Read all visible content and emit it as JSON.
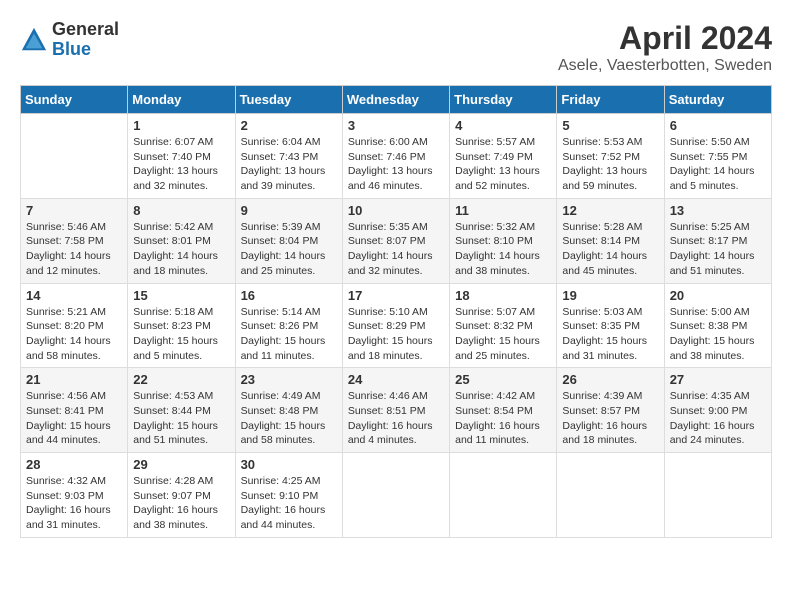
{
  "logo": {
    "general": "General",
    "blue": "Blue"
  },
  "title": {
    "month": "April 2024",
    "location": "Asele, Vaesterbotten, Sweden"
  },
  "headers": [
    "Sunday",
    "Monday",
    "Tuesday",
    "Wednesday",
    "Thursday",
    "Friday",
    "Saturday"
  ],
  "weeks": [
    [
      {
        "day": "",
        "content": ""
      },
      {
        "day": "1",
        "content": "Sunrise: 6:07 AM\nSunset: 7:40 PM\nDaylight: 13 hours\nand 32 minutes."
      },
      {
        "day": "2",
        "content": "Sunrise: 6:04 AM\nSunset: 7:43 PM\nDaylight: 13 hours\nand 39 minutes."
      },
      {
        "day": "3",
        "content": "Sunrise: 6:00 AM\nSunset: 7:46 PM\nDaylight: 13 hours\nand 46 minutes."
      },
      {
        "day": "4",
        "content": "Sunrise: 5:57 AM\nSunset: 7:49 PM\nDaylight: 13 hours\nand 52 minutes."
      },
      {
        "day": "5",
        "content": "Sunrise: 5:53 AM\nSunset: 7:52 PM\nDaylight: 13 hours\nand 59 minutes."
      },
      {
        "day": "6",
        "content": "Sunrise: 5:50 AM\nSunset: 7:55 PM\nDaylight: 14 hours\nand 5 minutes."
      }
    ],
    [
      {
        "day": "7",
        "content": "Sunrise: 5:46 AM\nSunset: 7:58 PM\nDaylight: 14 hours\nand 12 minutes."
      },
      {
        "day": "8",
        "content": "Sunrise: 5:42 AM\nSunset: 8:01 PM\nDaylight: 14 hours\nand 18 minutes."
      },
      {
        "day": "9",
        "content": "Sunrise: 5:39 AM\nSunset: 8:04 PM\nDaylight: 14 hours\nand 25 minutes."
      },
      {
        "day": "10",
        "content": "Sunrise: 5:35 AM\nSunset: 8:07 PM\nDaylight: 14 hours\nand 32 minutes."
      },
      {
        "day": "11",
        "content": "Sunrise: 5:32 AM\nSunset: 8:10 PM\nDaylight: 14 hours\nand 38 minutes."
      },
      {
        "day": "12",
        "content": "Sunrise: 5:28 AM\nSunset: 8:14 PM\nDaylight: 14 hours\nand 45 minutes."
      },
      {
        "day": "13",
        "content": "Sunrise: 5:25 AM\nSunset: 8:17 PM\nDaylight: 14 hours\nand 51 minutes."
      }
    ],
    [
      {
        "day": "14",
        "content": "Sunrise: 5:21 AM\nSunset: 8:20 PM\nDaylight: 14 hours\nand 58 minutes."
      },
      {
        "day": "15",
        "content": "Sunrise: 5:18 AM\nSunset: 8:23 PM\nDaylight: 15 hours\nand 5 minutes."
      },
      {
        "day": "16",
        "content": "Sunrise: 5:14 AM\nSunset: 8:26 PM\nDaylight: 15 hours\nand 11 minutes."
      },
      {
        "day": "17",
        "content": "Sunrise: 5:10 AM\nSunset: 8:29 PM\nDaylight: 15 hours\nand 18 minutes."
      },
      {
        "day": "18",
        "content": "Sunrise: 5:07 AM\nSunset: 8:32 PM\nDaylight: 15 hours\nand 25 minutes."
      },
      {
        "day": "19",
        "content": "Sunrise: 5:03 AM\nSunset: 8:35 PM\nDaylight: 15 hours\nand 31 minutes."
      },
      {
        "day": "20",
        "content": "Sunrise: 5:00 AM\nSunset: 8:38 PM\nDaylight: 15 hours\nand 38 minutes."
      }
    ],
    [
      {
        "day": "21",
        "content": "Sunrise: 4:56 AM\nSunset: 8:41 PM\nDaylight: 15 hours\nand 44 minutes."
      },
      {
        "day": "22",
        "content": "Sunrise: 4:53 AM\nSunset: 8:44 PM\nDaylight: 15 hours\nand 51 minutes."
      },
      {
        "day": "23",
        "content": "Sunrise: 4:49 AM\nSunset: 8:48 PM\nDaylight: 15 hours\nand 58 minutes."
      },
      {
        "day": "24",
        "content": "Sunrise: 4:46 AM\nSunset: 8:51 PM\nDaylight: 16 hours\nand 4 minutes."
      },
      {
        "day": "25",
        "content": "Sunrise: 4:42 AM\nSunset: 8:54 PM\nDaylight: 16 hours\nand 11 minutes."
      },
      {
        "day": "26",
        "content": "Sunrise: 4:39 AM\nSunset: 8:57 PM\nDaylight: 16 hours\nand 18 minutes."
      },
      {
        "day": "27",
        "content": "Sunrise: 4:35 AM\nSunset: 9:00 PM\nDaylight: 16 hours\nand 24 minutes."
      }
    ],
    [
      {
        "day": "28",
        "content": "Sunrise: 4:32 AM\nSunset: 9:03 PM\nDaylight: 16 hours\nand 31 minutes."
      },
      {
        "day": "29",
        "content": "Sunrise: 4:28 AM\nSunset: 9:07 PM\nDaylight: 16 hours\nand 38 minutes."
      },
      {
        "day": "30",
        "content": "Sunrise: 4:25 AM\nSunset: 9:10 PM\nDaylight: 16 hours\nand 44 minutes."
      },
      {
        "day": "",
        "content": ""
      },
      {
        "day": "",
        "content": ""
      },
      {
        "day": "",
        "content": ""
      },
      {
        "day": "",
        "content": ""
      }
    ]
  ]
}
